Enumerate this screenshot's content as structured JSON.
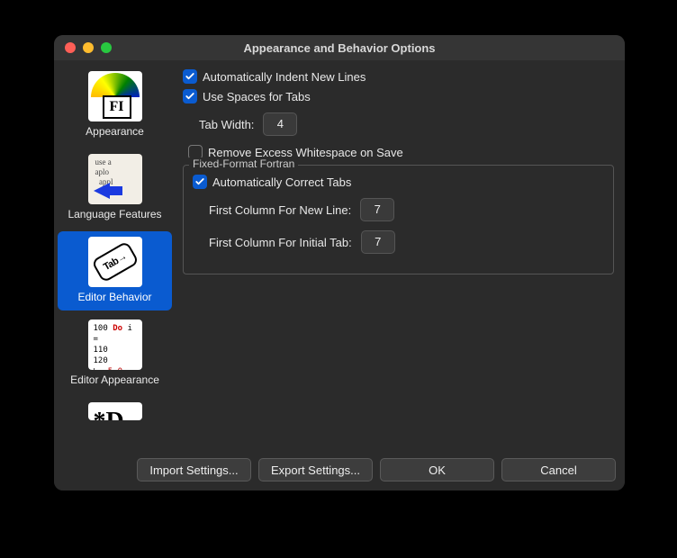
{
  "window": {
    "title": "Appearance and Behavior Options"
  },
  "sidebar": {
    "items": [
      {
        "label": "Appearance"
      },
      {
        "label": "Language Features"
      },
      {
        "label": "Editor Behavior"
      },
      {
        "label": "Editor Appearance"
      },
      {
        "label": ""
      }
    ]
  },
  "options": {
    "auto_indent_label": "Automatically Indent New Lines",
    "use_spaces_label": "Use Spaces for Tabs",
    "tab_width_label": "Tab Width:",
    "tab_width_value": "4",
    "remove_ws_label": "Remove Excess Whitespace on Save",
    "fixed_group_label": "Fixed-Format Fortran",
    "auto_correct_tabs_label": "Automatically Correct Tabs",
    "first_col_newline_label": "First Column For New Line:",
    "first_col_newline_value": "7",
    "first_col_tab_label": "First Column For Initial Tab:",
    "first_col_tab_value": "7"
  },
  "buttons": {
    "import": "Import Settings...",
    "export": "Export Settings...",
    "ok": "OK",
    "cancel": "Cancel"
  }
}
